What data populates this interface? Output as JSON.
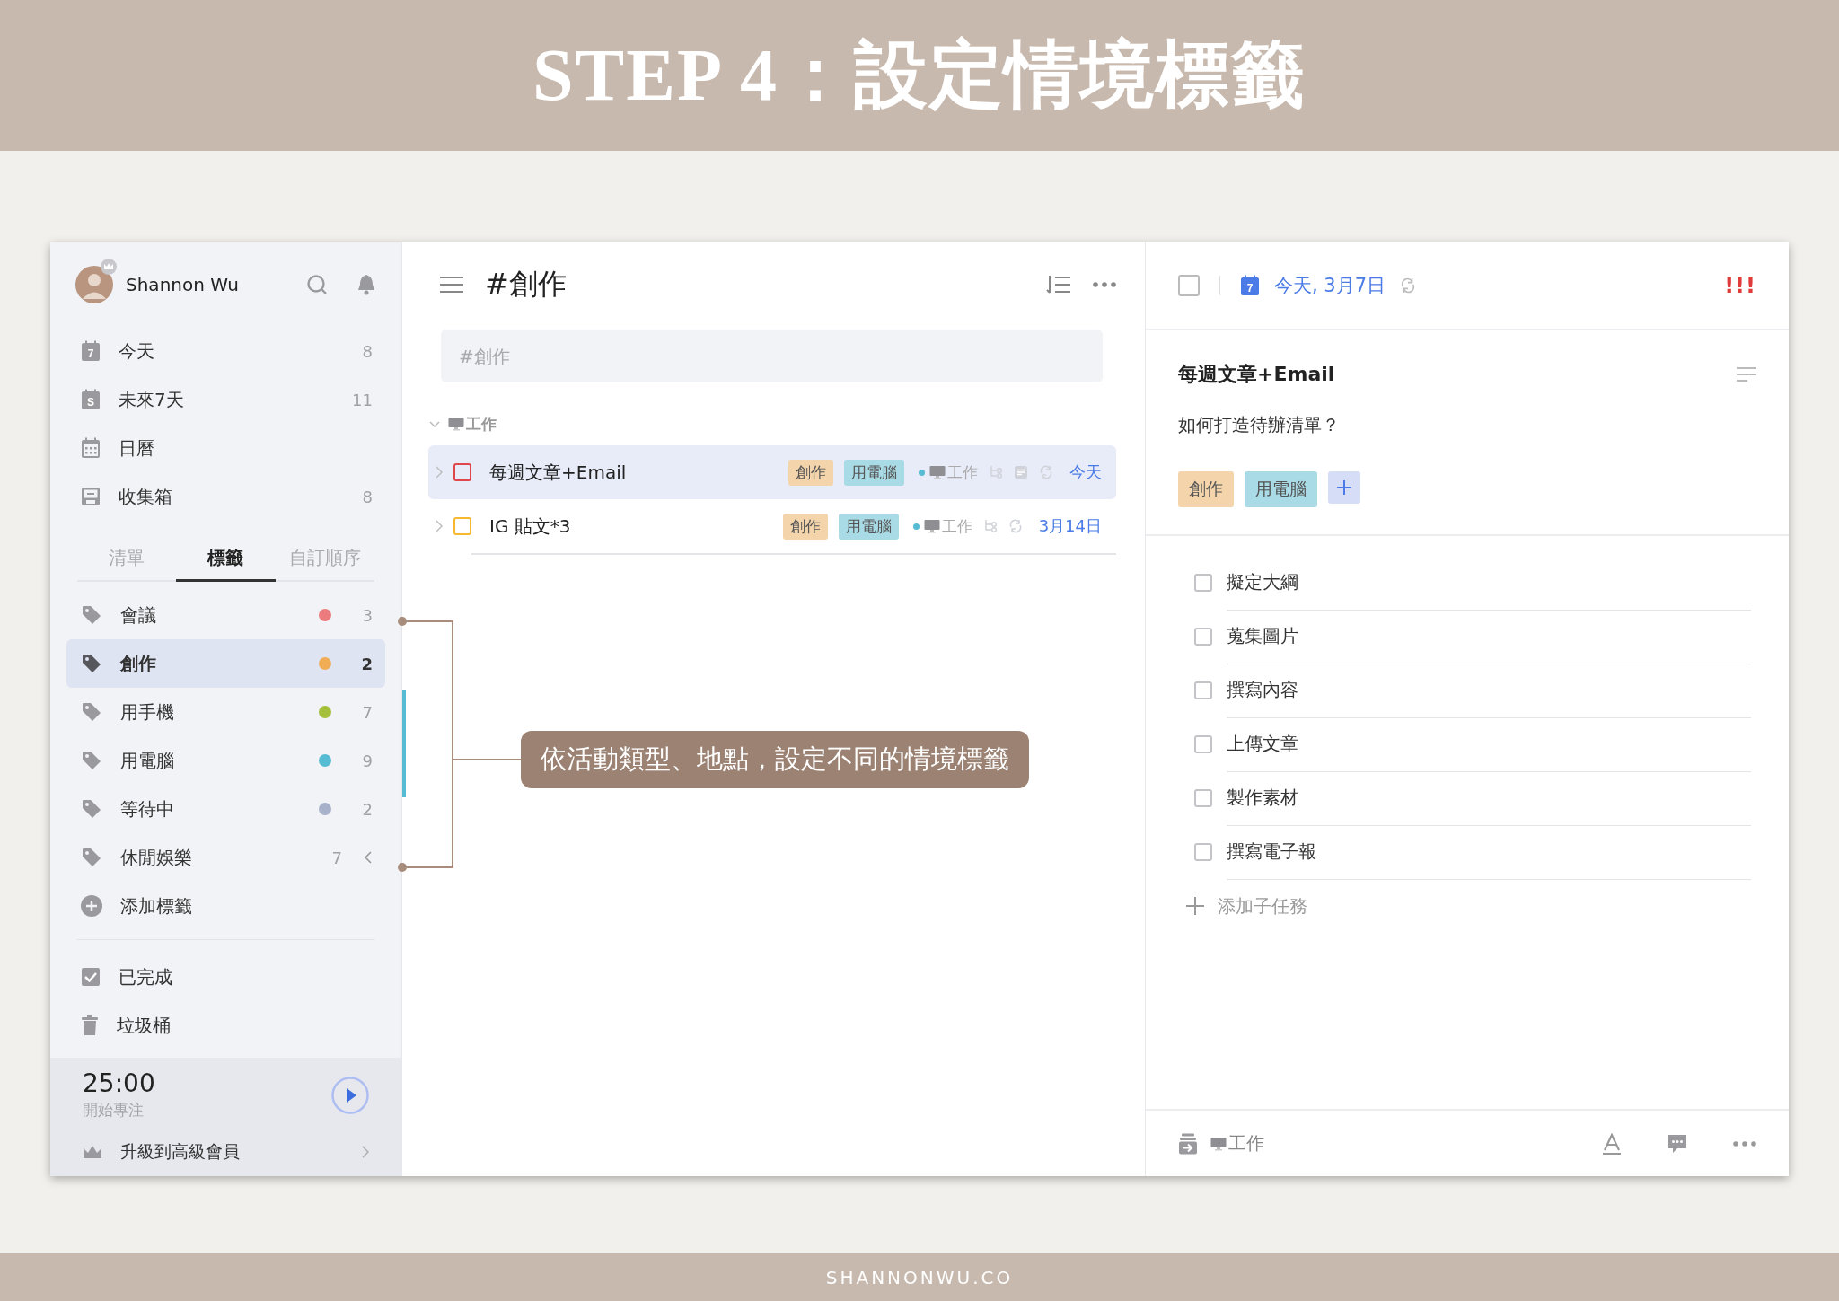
{
  "banner": {
    "title": "STEP 4：設定情境標籤"
  },
  "sidebar": {
    "user": {
      "name": "Shannon Wu"
    },
    "smart_lists": [
      {
        "kind": "today",
        "badge": "7",
        "label": "今天",
        "count": "8"
      },
      {
        "kind": "week",
        "badge": "S",
        "label": "未來7天",
        "count": "11"
      },
      {
        "kind": "calendar",
        "label": "日曆"
      },
      {
        "kind": "inbox",
        "label": "收集箱",
        "count": "8"
      }
    ],
    "tabs": [
      {
        "label": "清單",
        "selected": false
      },
      {
        "label": "標籤",
        "selected": true
      },
      {
        "label": "自訂順序",
        "selected": false
      }
    ],
    "tags": [
      {
        "kind": "tag",
        "label": "會議",
        "color": "#ec7b7d",
        "count": "3",
        "selected": false
      },
      {
        "kind": "tag",
        "label": "創作",
        "color": "#f0ad56",
        "count": "2",
        "selected": true
      },
      {
        "kind": "tag",
        "label": "用手機",
        "color": "#a4bf3c",
        "count": "7",
        "selected": false
      },
      {
        "kind": "tag",
        "label": "用電腦",
        "color": "#55bcd3",
        "count": "9",
        "selected": false
      },
      {
        "kind": "tag",
        "label": "等待中",
        "color": "#a7b1c9",
        "count": "2",
        "selected": false
      },
      {
        "kind": "group",
        "label": "休閒娛樂",
        "count": "7",
        "selected": false
      }
    ],
    "add_tag": "添加標籤",
    "bottom_items": [
      {
        "kind": "completed",
        "label": "已完成"
      },
      {
        "kind": "trash",
        "label": "垃圾桶"
      }
    ],
    "pomodoro": {
      "time": "25:00",
      "caption": "開始專注"
    },
    "upgrade": "升級到高級會員"
  },
  "list": {
    "title": "#創作",
    "add_placeholder": "#創作",
    "group": {
      "label": "工作",
      "expanded": true
    },
    "tasks": [
      {
        "title": "每週文章+Email",
        "color": "#e0474c",
        "selected": true,
        "tags": [
          {
            "label": "創作",
            "color": "#f3d4ab"
          },
          {
            "label": "用電腦",
            "color": "#a9dbe6"
          }
        ],
        "project": "工作",
        "has_note": true,
        "due": "今天"
      },
      {
        "title": "IG 貼文*3",
        "color": "#f5b82e",
        "selected": false,
        "tags": [
          {
            "label": "創作",
            "color": "#f3d4ab"
          },
          {
            "label": "用電腦",
            "color": "#a9dbe6"
          }
        ],
        "project": "工作",
        "has_note": false,
        "due": "3月14日"
      }
    ]
  },
  "detail": {
    "checked": false,
    "date_badge": "7",
    "date": "今天, 3月7日",
    "priority": "!!!",
    "title": "每週文章+Email",
    "note": "如何打造待辦清單？",
    "tags": [
      {
        "label": "創作",
        "color": "#f3d4ab"
      },
      {
        "label": "用電腦",
        "color": "#a9dbe6"
      }
    ],
    "subtasks": [
      {
        "title": "擬定大綱",
        "checked": false
      },
      {
        "title": "蒐集圖片",
        "checked": false
      },
      {
        "title": "撰寫內容",
        "checked": false
      },
      {
        "title": "上傳文章",
        "checked": false
      },
      {
        "title": "製作素材",
        "checked": false
      },
      {
        "title": "撰寫電子報",
        "checked": false
      }
    ],
    "add_subtask": "添加子任務",
    "project": "工作"
  },
  "callout": {
    "text": "依活動類型、地點，設定不同的情境標籤"
  },
  "footer": {
    "text": "SHANNONWU.CO"
  }
}
